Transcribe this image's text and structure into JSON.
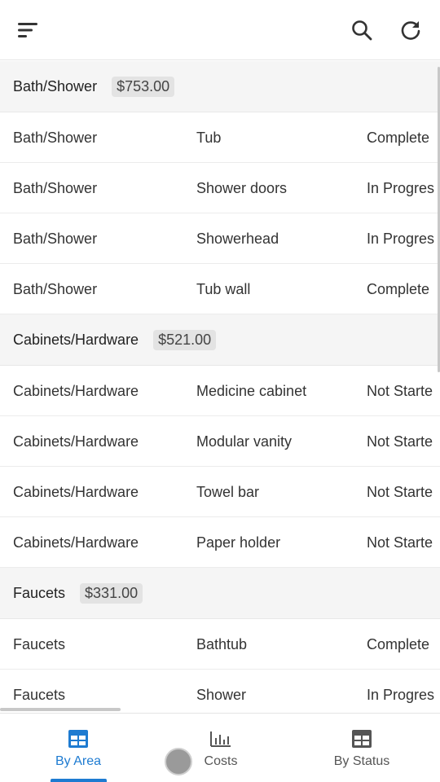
{
  "toolbar": {
    "menu_icon": "menu-icon",
    "search_icon": "search-icon",
    "refresh_icon": "refresh-icon"
  },
  "groups": [
    {
      "name": "Bath/Shower",
      "total": "$753.00",
      "rows": [
        {
          "area": "Bath/Shower",
          "item": "Tub",
          "status": "Complete"
        },
        {
          "area": "Bath/Shower",
          "item": "Shower doors",
          "status": "In Progres"
        },
        {
          "area": "Bath/Shower",
          "item": "Showerhead",
          "status": "In Progres"
        },
        {
          "area": "Bath/Shower",
          "item": "Tub wall",
          "status": "Complete"
        }
      ]
    },
    {
      "name": "Cabinets/Hardware",
      "total": "$521.00",
      "rows": [
        {
          "area": "Cabinets/Hardware",
          "item": "Medicine cabinet",
          "status": "Not Starte"
        },
        {
          "area": "Cabinets/Hardware",
          "item": "Modular vanity",
          "status": "Not Starte"
        },
        {
          "area": "Cabinets/Hardware",
          "item": "Towel bar",
          "status": "Not Starte"
        },
        {
          "area": "Cabinets/Hardware",
          "item": "Paper holder",
          "status": "Not Starte"
        }
      ]
    },
    {
      "name": "Faucets",
      "total": "$331.00",
      "rows": [
        {
          "area": "Faucets",
          "item": "Bathtub",
          "status": "Complete"
        },
        {
          "area": "Faucets",
          "item": "Shower",
          "status": "In Progres"
        }
      ]
    }
  ],
  "bottom_nav": {
    "items": [
      {
        "label": "By Area",
        "icon": "table-icon",
        "active": true
      },
      {
        "label": "Costs",
        "icon": "bar-chart-icon",
        "active": false
      },
      {
        "label": "By Status",
        "icon": "table-icon",
        "active": false
      }
    ]
  },
  "colors": {
    "accent": "#1e7bd1",
    "header_bg": "#f5f5f5",
    "total_badge_bg": "#e3e3e3"
  }
}
